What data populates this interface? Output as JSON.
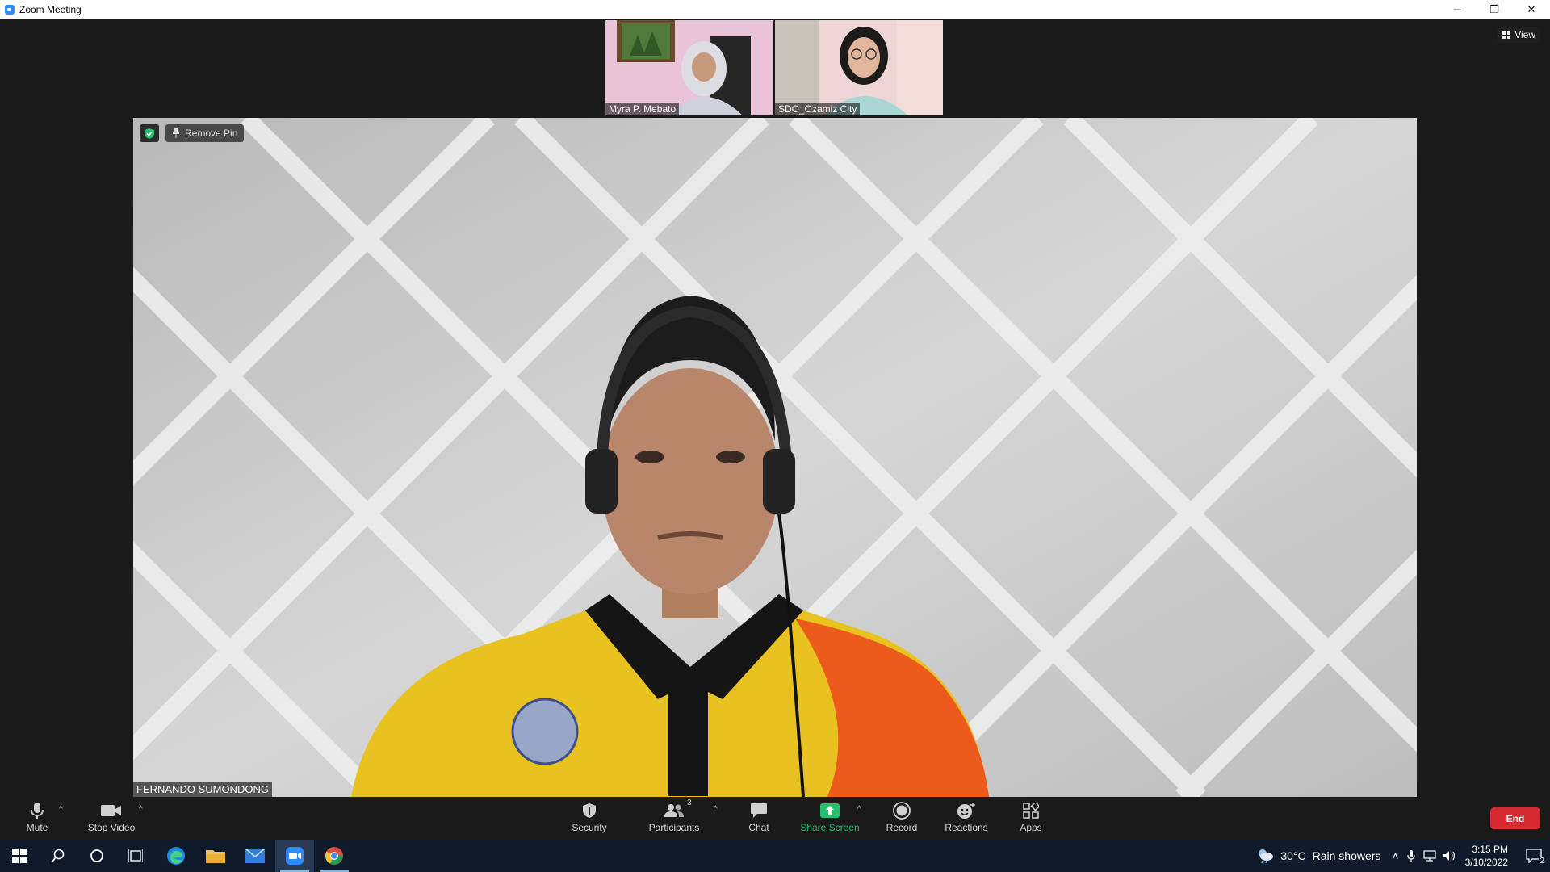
{
  "window": {
    "title": "Zoom Meeting"
  },
  "window_controls": {
    "minimize": "─",
    "restore": "❐",
    "close": "✕"
  },
  "view_button": {
    "label": "View"
  },
  "thumbnails": [
    {
      "name": "Myra P. Mebato"
    },
    {
      "name": "SDO_Ozamiz City"
    }
  ],
  "main_video": {
    "participant_name": "FERNANDO SUMONDONG",
    "remove_pin_label": "Remove Pin"
  },
  "toolbar": {
    "mute": "Mute",
    "stop_video": "Stop Video",
    "security": "Security",
    "participants": "Participants",
    "participants_count": "3",
    "chat": "Chat",
    "share_screen": "Share Screen",
    "record": "Record",
    "reactions": "Reactions",
    "apps": "Apps",
    "end": "End"
  },
  "taskbar": {
    "weather_temp": "30°C",
    "weather_desc": "Rain showers",
    "time": "3:15 PM",
    "date": "3/10/2022",
    "notification_count": "2"
  },
  "colors": {
    "accent_green": "#25c06d",
    "end_red": "#d5282f",
    "zoom_blue": "#2d8cff",
    "taskbar": "#0f1b2b"
  }
}
